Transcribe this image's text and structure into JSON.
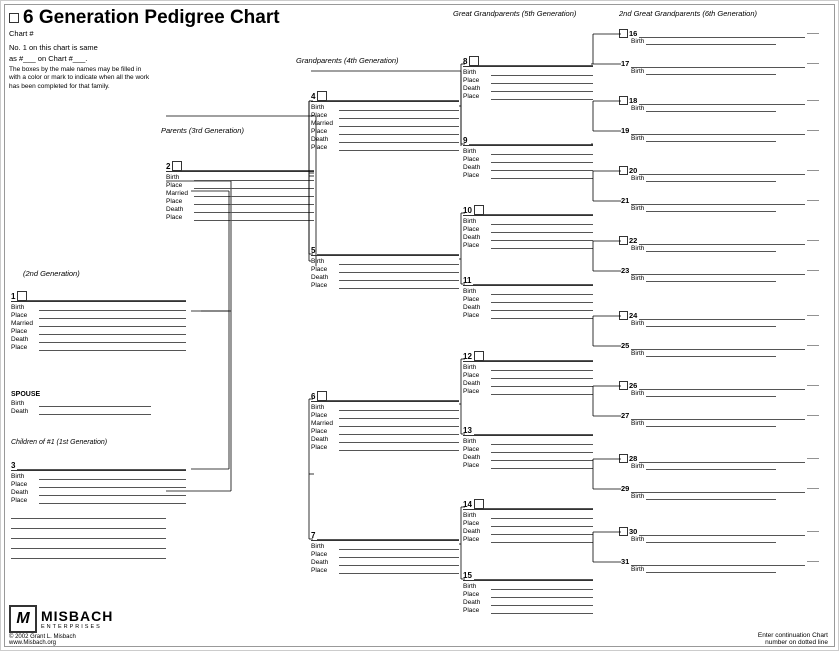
{
  "title": "6 Generation Pedigree Chart",
  "chart_num_label": "Chart #",
  "info1": "No. 1 on this chart is same",
  "info2": "as #___ on Chart #___.",
  "note": "The boxes by the male names may be filled in with a color or mark to indicate when all the work has been completed for that family.",
  "gen2_label": "(2nd Generation)",
  "gen3_label": "Parents (3rd Generation)",
  "gen4_label": "Grandparents (4th Generation)",
  "gen5_label": "Great Grandparents (5th Generation)",
  "gen6_label": "2nd Great Grandparents (6th Generation)",
  "fields": {
    "birth": "Birth",
    "place": "Place",
    "married": "Married",
    "death": "Death"
  },
  "persons": [
    {
      "num": "1",
      "fields": [
        "Birth",
        "Place",
        "Married",
        "Place",
        "Death",
        "Place"
      ]
    },
    {
      "num": "2",
      "fields": [
        "Birth",
        "Place",
        "Married",
        "Place",
        "Death",
        "Place"
      ]
    },
    {
      "num": "3",
      "fields": [
        "Birth",
        "Place",
        "Death",
        "Place"
      ]
    },
    {
      "num": "4",
      "fields": [
        "Birth",
        "Place",
        "Married",
        "Place",
        "Death",
        "Place"
      ]
    },
    {
      "num": "5",
      "fields": [
        "Birth",
        "Place",
        "Death",
        "Place"
      ]
    },
    {
      "num": "6",
      "fields": [
        "Birth",
        "Place",
        "Married",
        "Place",
        "Death",
        "Place"
      ]
    },
    {
      "num": "7",
      "fields": [
        "Birth",
        "Place",
        "Death",
        "Place"
      ]
    },
    {
      "num": "8",
      "fields": [
        "Birth",
        "Place",
        "Death",
        "Place"
      ]
    },
    {
      "num": "9",
      "fields": [
        "Birth",
        "Place",
        "Death",
        "Place"
      ]
    },
    {
      "num": "10",
      "fields": [
        "Birth",
        "Place",
        "Death",
        "Place"
      ]
    },
    {
      "num": "11",
      "fields": [
        "Birth",
        "Place",
        "Death",
        "Place"
      ]
    },
    {
      "num": "12",
      "fields": [
        "Birth",
        "Place",
        "Death",
        "Place"
      ]
    },
    {
      "num": "13",
      "fields": [
        "Birth",
        "Place",
        "Death",
        "Place"
      ]
    },
    {
      "num": "14",
      "fields": [
        "Birth",
        "Place",
        "Death",
        "Place"
      ]
    },
    {
      "num": "15",
      "fields": [
        "Birth",
        "Place",
        "Death",
        "Place"
      ]
    }
  ],
  "gen6_persons": [
    {
      "num": "16"
    },
    {
      "num": "17"
    },
    {
      "num": "18"
    },
    {
      "num": "19"
    },
    {
      "num": "20"
    },
    {
      "num": "21"
    },
    {
      "num": "22"
    },
    {
      "num": "23"
    },
    {
      "num": "24"
    },
    {
      "num": "25"
    },
    {
      "num": "26"
    },
    {
      "num": "27"
    },
    {
      "num": "28"
    },
    {
      "num": "29"
    },
    {
      "num": "30"
    },
    {
      "num": "31"
    }
  ],
  "spouse_label": "SPOUSE",
  "spouse_fields": [
    "Birth",
    "Death"
  ],
  "children_label": "Children of #1 (1st Generation)",
  "bottom_note": "Enter continuation Chart\nnumber on dotted line",
  "logo_main": "MISBACH",
  "logo_sub": "ENTERPRISES",
  "logo_copy": "© 2002 Grant L. Misbach",
  "logo_web": "www.Misbach.org"
}
